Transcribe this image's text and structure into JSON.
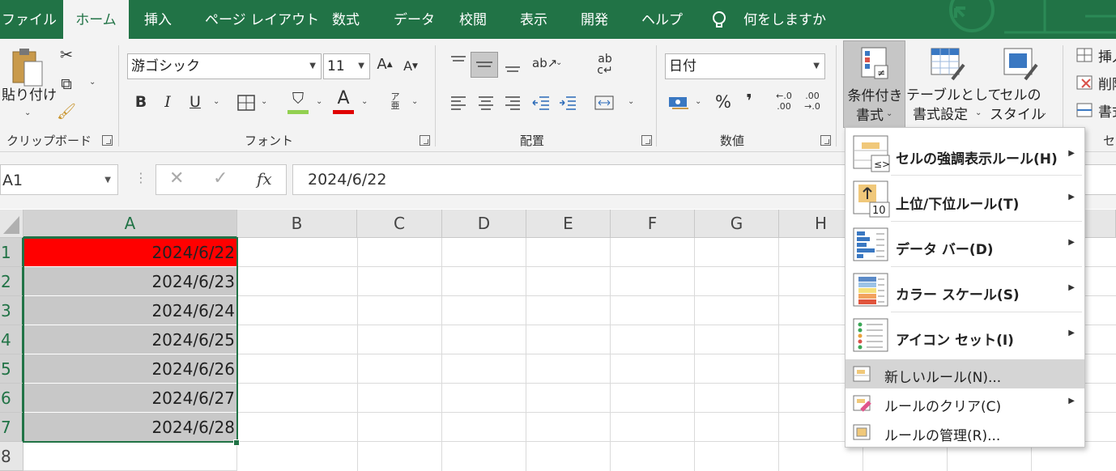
{
  "tabs": [
    "ファイル",
    "ホーム",
    "挿入",
    "ページ レイアウト",
    "数式",
    "データ",
    "校閲",
    "表示",
    "開発",
    "ヘルプ"
  ],
  "active_tab": "ホーム",
  "tell_me": "何をしますか",
  "ribbon": {
    "clipboard": {
      "paste": "貼り付け",
      "label": "クリップボード"
    },
    "font": {
      "name": "游ゴシック",
      "size": "11",
      "label": "フォント",
      "bold": "B",
      "italic": "I",
      "underline": "U"
    },
    "alignment": {
      "label": "配置"
    },
    "number": {
      "format": "日付",
      "percent": "%",
      "comma": "❜",
      "label": "数値"
    },
    "styles": {
      "conditional_line1": "条件付き",
      "conditional_line2": "書式",
      "table_line1": "テーブルとして",
      "table_line2": "書式設定",
      "cellstyle_line1": "セルの",
      "cellstyle_line2": "スタイル"
    },
    "cells": {
      "insert": "挿入",
      "delete": "削除",
      "format": "書式",
      "label": "セル"
    }
  },
  "formula_bar": {
    "name_box": "A1",
    "fx": "fx",
    "value": "2024/6/22"
  },
  "columns": [
    "A",
    "B",
    "C",
    "D",
    "E",
    "F",
    "G",
    "H"
  ],
  "rows": [
    "1",
    "2",
    "3",
    "4",
    "5",
    "6",
    "7",
    "8"
  ],
  "cells_a": [
    "2024/6/22",
    "2024/6/23",
    "2024/6/24",
    "2024/6/25",
    "2024/6/26",
    "2024/6/27",
    "2024/6/28",
    ""
  ],
  "highlight_color": "#ff0000",
  "selection_fill": "#c8c8c8",
  "accent": "#217346",
  "menu": {
    "items": [
      {
        "label": "セルの強調表示ルール(H)",
        "icon": "highlight-rules-icon",
        "submenu": true
      },
      {
        "label": "上位/下位ルール(T)",
        "icon": "top-bottom-rules-icon",
        "submenu": true
      },
      {
        "label": "データ バー(D)",
        "icon": "data-bars-icon",
        "submenu": true
      },
      {
        "label": "カラー スケール(S)",
        "icon": "color-scales-icon",
        "submenu": true
      },
      {
        "label": "アイコン セット(I)",
        "icon": "icon-sets-icon",
        "submenu": true
      }
    ],
    "small_items": [
      {
        "label": "新しいルール(N)...",
        "icon": "new-rule-icon",
        "submenu": false,
        "highlighted": true
      },
      {
        "label": "ルールのクリア(C)",
        "icon": "clear-rules-icon",
        "submenu": true,
        "highlighted": false
      },
      {
        "label": "ルールの管理(R)...",
        "icon": "manage-rules-icon",
        "submenu": false,
        "highlighted": false
      }
    ]
  }
}
